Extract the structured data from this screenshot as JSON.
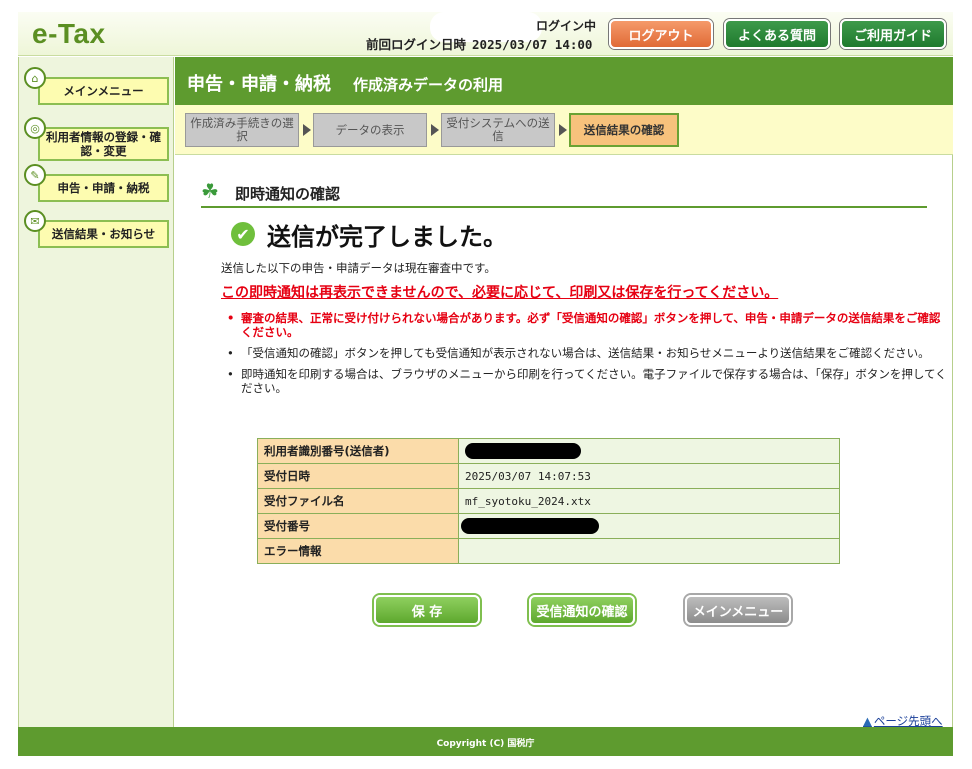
{
  "header": {
    "logo": "e-Tax",
    "login_status": "ログイン中",
    "last_login_label": "前回ログイン日時",
    "last_login_value": "2025/03/07 14:00",
    "logout": "ログアウト",
    "faq": "よくある質問",
    "guide": "ご利用ガイド"
  },
  "sidebar": {
    "items": [
      {
        "label": "メインメニュー",
        "icon": "home-icon"
      },
      {
        "label": "利用者情報の登録・確認・変更",
        "icon": "user-icon"
      },
      {
        "label": "申告・申請・納税",
        "icon": "document-icon"
      },
      {
        "label": "送信結果・お知らせ",
        "icon": "mail-icon"
      }
    ]
  },
  "title": {
    "main": "申告・申請・納税",
    "sub": "作成済みデータの利用"
  },
  "steps": [
    {
      "label": "作成済み手続きの選択",
      "active": false
    },
    {
      "label": "データの表示",
      "active": false
    },
    {
      "label": "受付システムへの送信",
      "active": false
    },
    {
      "label": "送信結果の確認",
      "active": true
    }
  ],
  "section": {
    "title": "即時通知の確認",
    "heading": "送信が完了しました。",
    "notice": "送信した以下の申告・申請データは現在審査中です。",
    "warning": "この即時通知は再表示できませんので、必要に応じて、印刷又は保存を行ってください。",
    "bullets": [
      {
        "text": "審査の結果、正常に受け付けられない場合があります。必ず「受信通知の確認」ボタンを押して、申告・申請データの送信結果をご確認ください。",
        "red": true
      },
      {
        "text": "「受信通知の確認」ボタンを押しても受信通知が表示されない場合は、送信結果・お知らせメニューより送信結果をご確認ください。",
        "red": false
      },
      {
        "text": "即時通知を印刷する場合は、ブラウザのメニューから印刷を行ってください。電子ファイルで保存する場合は、「保存」ボタンを押してください。",
        "red": false
      }
    ]
  },
  "table": {
    "rows": [
      {
        "label": "利用者識別番号(送信者)",
        "value": "",
        "redacted": true
      },
      {
        "label": "受付日時",
        "value": "2025/03/07 14:07:53",
        "redacted": false
      },
      {
        "label": "受付ファイル名",
        "value": "mf_syotoku_2024.xtx",
        "redacted": false
      },
      {
        "label": "受付番号",
        "value": "",
        "redacted": true
      },
      {
        "label": "エラー情報",
        "value": "",
        "redacted": false
      }
    ]
  },
  "buttons": {
    "save": "保 存",
    "receipt_check": "受信通知の確認",
    "main_menu": "メインメニュー"
  },
  "page_top": "ページ先頭へ",
  "footer": {
    "copyright": "Copyright (C) 国税庁"
  },
  "colors": {
    "brand_green": "#5e9b2f",
    "warning_red": "#e60012",
    "logout_orange": "#e06a36"
  }
}
